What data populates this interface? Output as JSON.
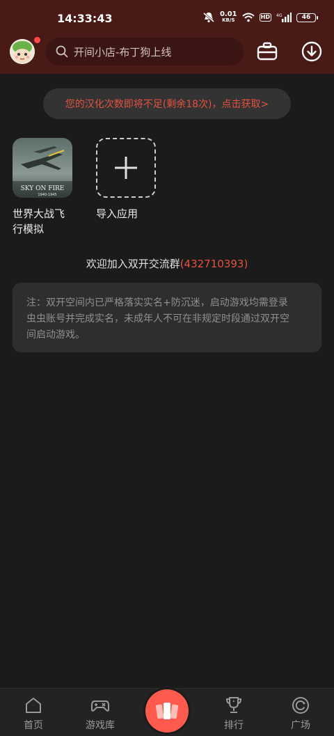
{
  "status_bar": {
    "time": "14:33:43",
    "net_speed": "0.01",
    "net_unit": "KB/S",
    "hd": "HD",
    "signal": "4G",
    "battery": "46"
  },
  "header": {
    "search_placeholder": "开间小店-布丁狗上线",
    "icons": [
      "avatar",
      "toolbox-icon",
      "download-icon"
    ]
  },
  "notice": {
    "text": "您的汉化次数即将不足(剩余18次)，点击获取>"
  },
  "apps": [
    {
      "label_line1": "世界大战飞",
      "label_line2": "行模拟",
      "thumb_text_1": "SKY ON FIRE",
      "thumb_text_2": "1940-1945"
    },
    {
      "label_line1": "导入应用"
    }
  ],
  "group": {
    "prefix": "欢迎加入双开交流群",
    "number": "(432710393)"
  },
  "note": {
    "line1": "注：双开空间内已严格落实实名+防沉迷，启动游戏均需登录",
    "line2": "虫虫账号并完成实名，未成年人不可在非规定时段通过双开空",
    "line3": "间启动游戏。"
  },
  "tabbar": {
    "tabs": [
      {
        "label": "首页",
        "icon": "home-icon"
      },
      {
        "label": "游戏库",
        "icon": "gamepad-icon"
      },
      {
        "label": "",
        "icon": "center-cards-icon"
      },
      {
        "label": "排行",
        "icon": "trophy-icon"
      },
      {
        "label": "广场",
        "icon": "plaza-icon"
      }
    ]
  },
  "colors": {
    "header_bg": "#4a1a17",
    "accent": "#e5523f",
    "center_button": "#ff5a4e",
    "background": "#1b1b1b"
  }
}
